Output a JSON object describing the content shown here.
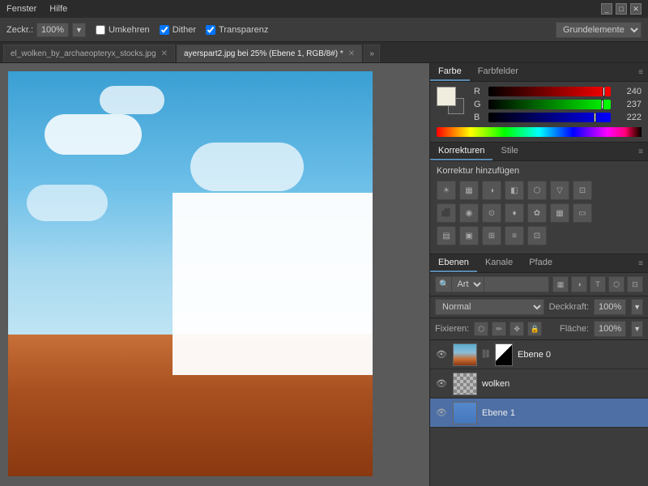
{
  "titlebar": {
    "menus": [
      "Fenster",
      "Hilfe"
    ],
    "controls": [
      "_",
      "□",
      "✕"
    ]
  },
  "optionsbar": {
    "zoom_label": "Zeckr.:",
    "zoom_value": "100%",
    "umkehren_label": "Umkehren",
    "dither_label": "Dither",
    "transparenz_label": "Transparenz",
    "workspace": "Grundelemente"
  },
  "tabs": [
    {
      "label": "el_wolken_by_archaeopteryx_stocks.jpg",
      "active": false
    },
    {
      "label": "ayerspart2.jpg bei 25% (Ebene 1, RGB/8#) *",
      "active": true
    }
  ],
  "color_panel": {
    "tabs": [
      "Farbe",
      "Farbfelder"
    ],
    "active_tab": "Farbe",
    "r": {
      "label": "R",
      "value": 240,
      "max": 255
    },
    "g": {
      "label": "G",
      "value": 237,
      "max": 255
    },
    "b": {
      "label": "B",
      "value": 222,
      "max": 255
    }
  },
  "korrekturen_panel": {
    "tabs": [
      "Korrekturen",
      "Stile"
    ],
    "active_tab": "Korrekturen",
    "title": "Korrektur hinzufügen",
    "icons_row1": [
      "☀",
      "▦",
      "◑",
      "◧",
      "⬡",
      "▽"
    ],
    "icons_row2": [
      "⬛",
      "◉",
      "⊙",
      "♦",
      "✿",
      "▦"
    ],
    "icons_row3": [
      "▤",
      "▣",
      "⬡",
      "⬡",
      "▦"
    ]
  },
  "ebenen_panel": {
    "tabs": [
      "Ebenen",
      "Kanale",
      "Pfade"
    ],
    "active_tab": "Ebenen",
    "search_placeholder": "Art",
    "blend_mode": "Normal",
    "deckkraft_label": "Deckkraft:",
    "deckkraft_value": "100%",
    "fixieren_label": "Fixieren:",
    "flache_label": "Fläche:",
    "flache_value": "100%",
    "layers": [
      {
        "name": "Ebene 0",
        "visible": true,
        "selected": false,
        "has_mask": true
      },
      {
        "name": "wolken",
        "visible": true,
        "selected": false,
        "has_mask": false,
        "is_checker": true
      },
      {
        "name": "Ebene 1",
        "visible": true,
        "selected": true,
        "has_mask": false,
        "is_blue": true
      }
    ]
  }
}
